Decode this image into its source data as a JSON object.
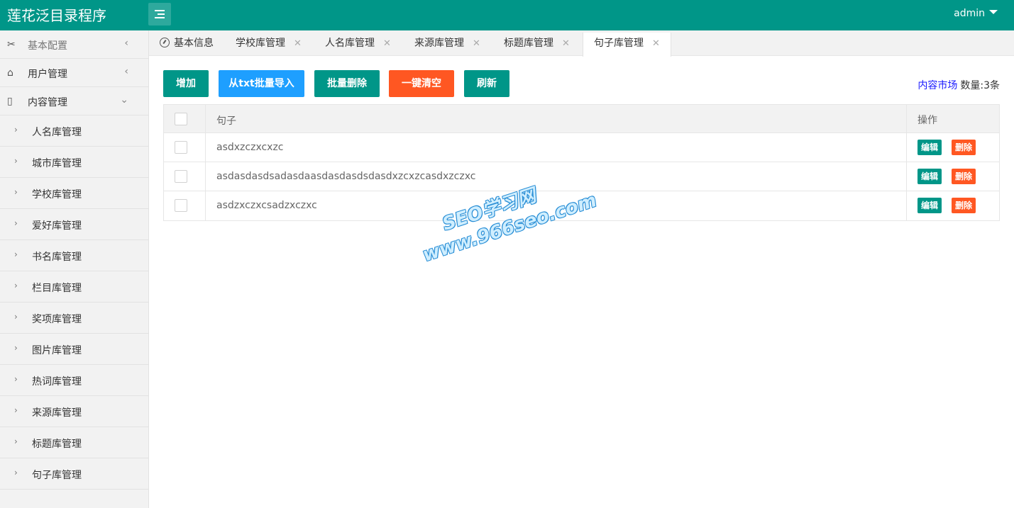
{
  "header": {
    "app_title": "莲花泛目录程序",
    "user": "admin"
  },
  "sidebar": {
    "top_items": [
      {
        "label": "基本配置",
        "icon": "tools-icon"
      },
      {
        "label": "用户管理",
        "icon": "home-icon"
      },
      {
        "label": "内容管理",
        "icon": "document-icon"
      }
    ],
    "sub_items": [
      {
        "label": "人名库管理"
      },
      {
        "label": "城市库管理"
      },
      {
        "label": "学校库管理"
      },
      {
        "label": "爱好库管理"
      },
      {
        "label": "书名库管理"
      },
      {
        "label": "栏目库管理"
      },
      {
        "label": "奖项库管理"
      },
      {
        "label": "图片库管理"
      },
      {
        "label": "热词库管理"
      },
      {
        "label": "来源库管理"
      },
      {
        "label": "标题库管理"
      },
      {
        "label": "句子库管理"
      }
    ]
  },
  "tabs": [
    {
      "label": "基本信息"
    },
    {
      "label": "学校库管理"
    },
    {
      "label": "人名库管理"
    },
    {
      "label": "来源库管理"
    },
    {
      "label": "标题库管理"
    },
    {
      "label": "句子库管理"
    }
  ],
  "toolbar": {
    "add": "增加",
    "import": "从txt批量导入",
    "batch_delete": "批量删除",
    "clear_all": "一键清空",
    "refresh": "刷新"
  },
  "market": {
    "link": "内容市场",
    "count": "数量:3条"
  },
  "table": {
    "header": {
      "sentence": "句子",
      "ops": "操作"
    },
    "rows": [
      {
        "text": "asdxzczxcxzc"
      },
      {
        "text": "asdasdasdsadasdaasdasdasdsdasdxzcxzcasdxzczxc"
      },
      {
        "text": "asdzxczxcsadzxczxc"
      }
    ],
    "edit_label": "编辑",
    "delete_label": "删除"
  },
  "watermark": {
    "line1": "SEO学习网",
    "line2": "www.966seo.com"
  },
  "colors": {
    "primary": "#009688",
    "blue": "#1E9FFF",
    "orange": "#FF5722"
  }
}
